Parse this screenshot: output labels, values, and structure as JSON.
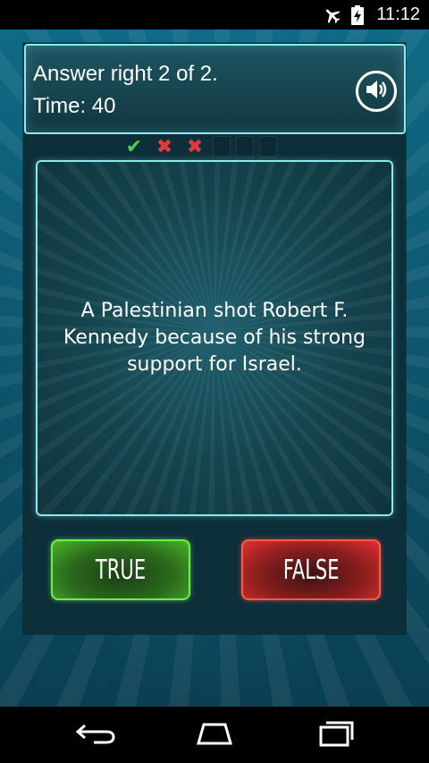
{
  "status_bar": {
    "time": "11:12",
    "icons": [
      "airplane-mode-icon",
      "battery-charging-icon"
    ]
  },
  "header": {
    "score_text": "Answer right 2 of 2.",
    "time_text": "Time: 40",
    "sound_icon": "speaker-icon"
  },
  "progress": {
    "marks": [
      {
        "state": "correct",
        "glyph": "✔"
      },
      {
        "state": "wrong",
        "glyph": "✖"
      },
      {
        "state": "wrong",
        "glyph": "✖"
      },
      {
        "state": "pending",
        "glyph": ""
      },
      {
        "state": "pending",
        "glyph": ""
      },
      {
        "state": "pending",
        "glyph": ""
      }
    ]
  },
  "question": {
    "text": "A Palestinian shot Robert F. Kennedy because of his strong support for Israel."
  },
  "answers": {
    "true_label": "TRUE",
    "false_label": "FALSE"
  },
  "colors": {
    "accent_cyan": "#8ee8ef",
    "true_green": "#6ef04a",
    "false_red": "#ff5a4a",
    "correct_mark": "#4bd24b",
    "wrong_mark": "#e23a3a"
  },
  "nav_bar": {
    "icons": [
      "back-icon",
      "home-icon",
      "recent-apps-icon"
    ]
  }
}
